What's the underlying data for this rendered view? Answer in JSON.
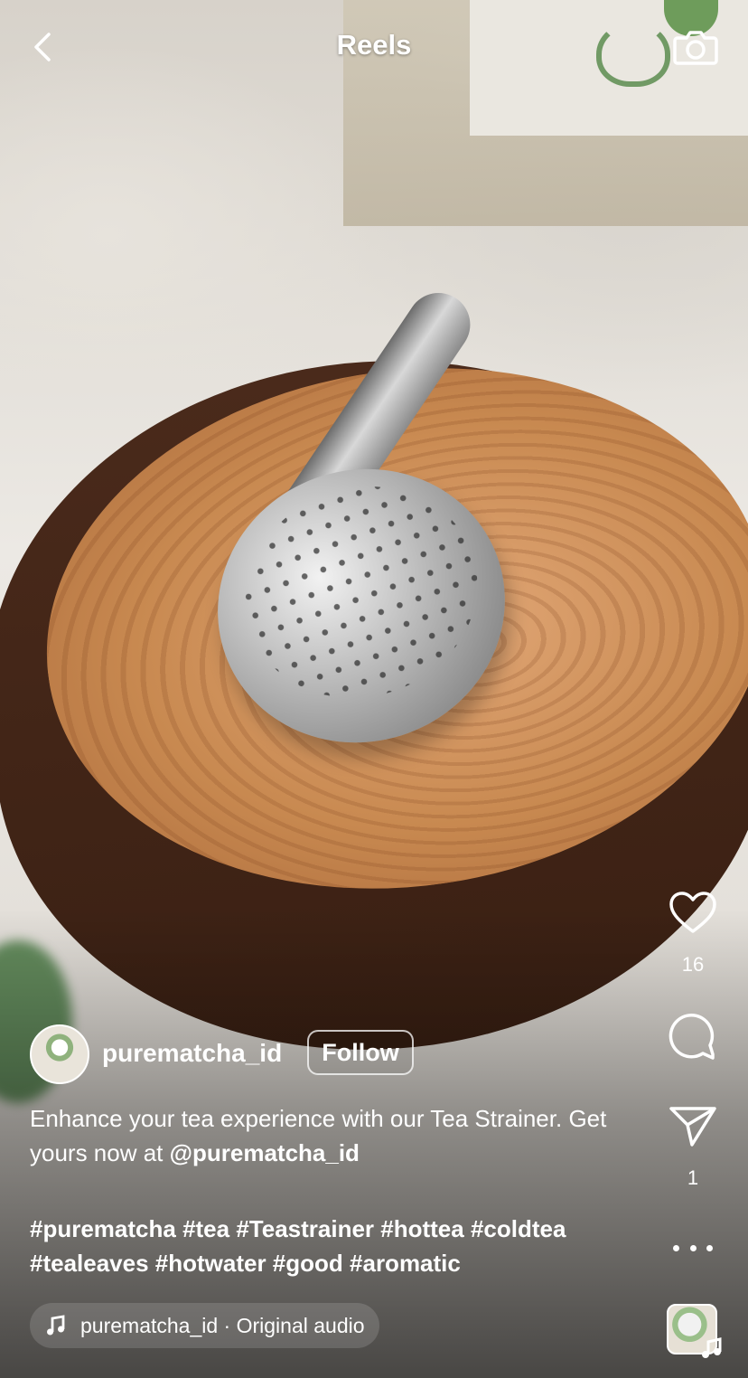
{
  "header": {
    "title": "Reels"
  },
  "post": {
    "username": "purematcha_id",
    "follow_label": "Follow",
    "caption_text": "Enhance your tea experience with our Tea Strainer. Get yours now at ",
    "caption_mention": "@purematcha_id",
    "hashtags": "#purematcha #tea #Teastrainer #hottea #coldtea #tealeaves #hotwater #good #aromatic",
    "audio_label": "purematcha_id · Original audio"
  },
  "actions": {
    "likes": "16",
    "shares": "1"
  },
  "icons": {
    "back": "chevron-left-icon",
    "camera": "camera-icon",
    "like": "heart-icon",
    "comment": "comment-bubble-icon",
    "share": "paper-plane-icon",
    "more": "more-horizontal-icon",
    "music": "music-note-icon"
  },
  "colors": {
    "text": "#ffffff",
    "overlay": "#000000"
  }
}
